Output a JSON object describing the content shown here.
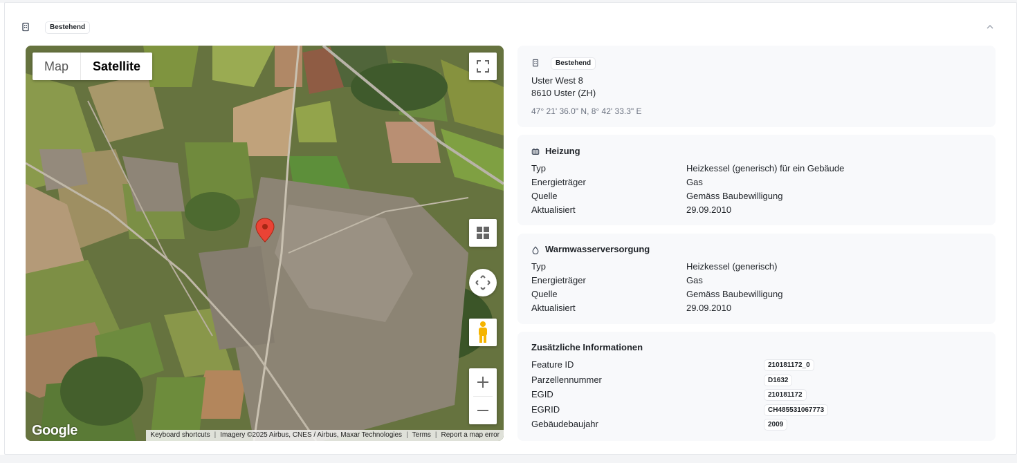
{
  "header": {
    "status_badge": "Bestehend"
  },
  "map": {
    "type_map": "Map",
    "type_satellite": "Satellite",
    "logo": "Google",
    "attribution": {
      "keyboard": "Keyboard shortcuts",
      "imagery": "Imagery ©2025 Airbus, CNES / Airbus, Maxar Technologies",
      "terms": "Terms",
      "report": "Report a map error"
    },
    "icons": [
      "fullscreen-icon",
      "tilt-grid-icon",
      "rotate-icon",
      "pegman-icon",
      "zoom-in-icon",
      "zoom-out-icon",
      "map-marker-icon"
    ]
  },
  "address": {
    "badge": "Bestehend",
    "street": "Uster West 8",
    "city": "8610 Uster (ZH)",
    "coords": "47° 21' 36.0\" N, 8° 42' 33.3\" E"
  },
  "heating": {
    "title": "Heizung",
    "rows": [
      {
        "label": "Typ",
        "value": "Heizkessel (generisch) für ein Gebäude"
      },
      {
        "label": "Energieträger",
        "value": "Gas"
      },
      {
        "label": "Quelle",
        "value": "Gemäss Baubewilligung"
      },
      {
        "label": "Aktualisiert",
        "value": "29.09.2010"
      }
    ]
  },
  "hotwater": {
    "title": "Warmwasserversorgung",
    "rows": [
      {
        "label": "Typ",
        "value": "Heizkessel (generisch)"
      },
      {
        "label": "Energieträger",
        "value": "Gas"
      },
      {
        "label": "Quelle",
        "value": "Gemäss Baubewilligung"
      },
      {
        "label": "Aktualisiert",
        "value": "29.09.2010"
      }
    ]
  },
  "extra": {
    "title": "Zusätzliche Informationen",
    "rows": [
      {
        "label": "Feature ID",
        "value": "210181172_0"
      },
      {
        "label": "Parzellennummer",
        "value": "D1632"
      },
      {
        "label": "EGID",
        "value": "210181172"
      },
      {
        "label": "EGRID",
        "value": "CH485531067773"
      },
      {
        "label": "Gebäudebaujahr",
        "value": "2009"
      }
    ]
  },
  "colors": {
    "panel_bg": "#f8f9fb",
    "muted": "#6b7280",
    "marker": "#ea4335"
  }
}
